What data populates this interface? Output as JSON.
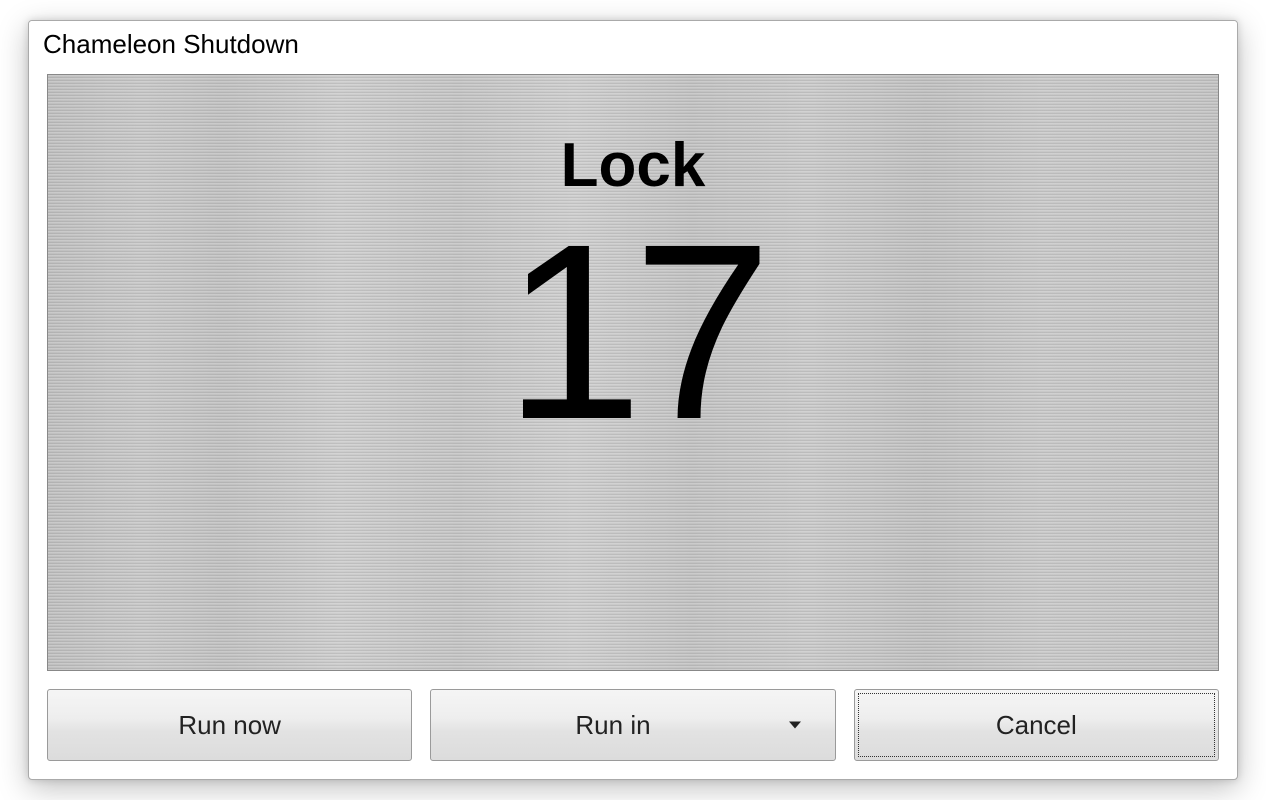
{
  "window": {
    "title": "Chameleon Shutdown"
  },
  "countdown": {
    "action_label": "Lock",
    "seconds": "17"
  },
  "buttons": {
    "run_now": "Run now",
    "run_in": "Run in",
    "cancel": "Cancel"
  }
}
